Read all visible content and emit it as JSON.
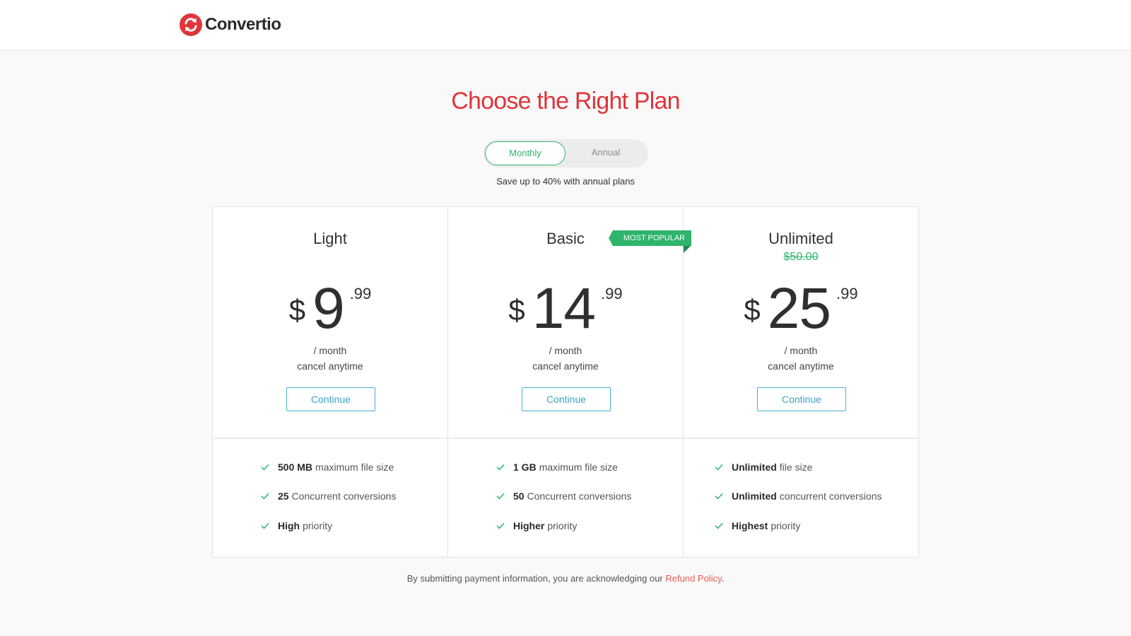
{
  "header": {
    "logo_text": "Convertio",
    "brand_color": "#e0353b"
  },
  "page": {
    "title": "Choose the Right Plan",
    "billing_toggle": {
      "monthly": "Monthly",
      "annual": "Annual",
      "selected": "Monthly"
    },
    "save_note": "Save up to 40% with annual plans"
  },
  "plans": [
    {
      "name": "Light",
      "old_price": "",
      "currency": "$",
      "amount": "9",
      "cents": ".99",
      "period": "/ month",
      "cancel": "cancel anytime",
      "button": "Continue",
      "features": [
        {
          "bold": "500 MB",
          "text": "maximum file size"
        },
        {
          "bold": "25",
          "text": "Concurrent conversions"
        },
        {
          "bold": "High",
          "text": "priority"
        }
      ]
    },
    {
      "name": "Basic",
      "old_price": "",
      "badge": "MOST POPULAR",
      "currency": "$",
      "amount": "14",
      "cents": ".99",
      "period": "/ month",
      "cancel": "cancel anytime",
      "button": "Continue",
      "features": [
        {
          "bold": "1 GB",
          "text": "maximum file size"
        },
        {
          "bold": "50",
          "text": "Concurrent conversions"
        },
        {
          "bold": "Higher",
          "text": "priority"
        }
      ]
    },
    {
      "name": "Unlimited",
      "old_price": "$50.00",
      "currency": "$",
      "amount": "25",
      "cents": ".99",
      "period": "/ month",
      "cancel": "cancel anytime",
      "button": "Continue",
      "features": [
        {
          "bold": "Unlimited",
          "text": "file size"
        },
        {
          "bold": "Unlimited",
          "text": "concurrent conversions"
        },
        {
          "bold": "Highest",
          "text": "priority"
        }
      ]
    }
  ],
  "footer": {
    "text": "By submitting payment information, you are acknowledging our",
    "link": "Refund Policy",
    "end": "."
  },
  "colors": {
    "accent_green": "#2fb46b",
    "button_blue": "#3aa4c6",
    "title_red": "#e0353b",
    "link_red": "#e85c57"
  },
  "icons": {
    "logo": "convertio-logo-icon",
    "feature": "check-icon"
  }
}
